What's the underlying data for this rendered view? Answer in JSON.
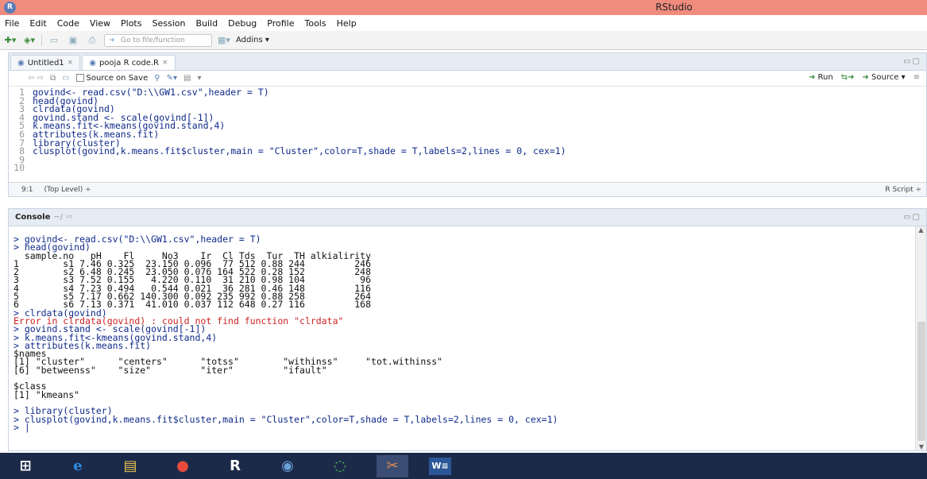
{
  "window": {
    "title": "RStudio",
    "logo": "R"
  },
  "menu": [
    "File",
    "Edit",
    "Code",
    "View",
    "Plots",
    "Session",
    "Build",
    "Debug",
    "Profile",
    "Tools",
    "Help"
  ],
  "toolbar": {
    "goto_placeholder": "Go to file/function",
    "addins": "Addins ▾"
  },
  "editor": {
    "tabs": [
      {
        "label": "Untitled1"
      },
      {
        "label": "pooja R code.R"
      }
    ],
    "source_on_save": "Source on Save",
    "run": "Run",
    "source": "Source",
    "lines": [
      "govind<- read.csv(\"D:\\\\GW1.csv\",header = T)",
      "head(govind)",
      "clrdata(govind)",
      "govind.stand <- scale(govind[-1])",
      "k.means.fit<-kmeans(govind.stand,4)",
      "attributes(k.means.fit)",
      "library(cluster)",
      "clusplot(govind,k.means.fit$cluster,main = \"Cluster\",color=T,shade = T,labels=2,lines = 0, cex=1)",
      "",
      ""
    ],
    "status": {
      "position": "9:1",
      "scope": "(Top Level) ÷",
      "type": "R Script ÷"
    }
  },
  "console": {
    "title": "Console",
    "path": "~/",
    "lines": [
      {
        "t": "in",
        "s": "> govind<- read.csv(\"D:\\\\GW1.csv\",header = T)"
      },
      {
        "t": "in",
        "s": "> head(govind)"
      },
      {
        "t": "out",
        "s": "  sample.no   pH    Fl     No3    Ir  Cl Tds  Tur  TH alkialirity"
      },
      {
        "t": "out",
        "s": "1        s1 7.46 0.325  23.150 0.096  77 512 0.88 244         246"
      },
      {
        "t": "out",
        "s": "2        s2 6.48 0.245  23.050 0.076 164 522 0.28 152         248"
      },
      {
        "t": "out",
        "s": "3        s3 7.52 0.155   4.220 0.110  31 210 0.98 104          96"
      },
      {
        "t": "out",
        "s": "4        s4 7.23 0.494   0.544 0.021  36 281 0.46 148         116"
      },
      {
        "t": "out",
        "s": "5        s5 7.17 0.662 140.300 0.092 235 992 0.88 258         264"
      },
      {
        "t": "out",
        "s": "6        s6 7.13 0.371  41.010 0.037 112 648 0.27 116         168"
      },
      {
        "t": "in",
        "s": "> clrdata(govind)"
      },
      {
        "t": "err",
        "s": "Error in clrdata(govind) : could not find function \"clrdata\""
      },
      {
        "t": "in",
        "s": "> govind.stand <- scale(govind[-1])"
      },
      {
        "t": "in",
        "s": "> k.means.fit<-kmeans(govind.stand,4)"
      },
      {
        "t": "in",
        "s": "> attributes(k.means.fit)"
      },
      {
        "t": "out",
        "s": "$names"
      },
      {
        "t": "out",
        "s": "[1] \"cluster\"      \"centers\"      \"totss\"        \"withinss\"     \"tot.withinss\""
      },
      {
        "t": "out",
        "s": "[6] \"betweenss\"    \"size\"         \"iter\"         \"ifault\""
      },
      {
        "t": "out",
        "s": ""
      },
      {
        "t": "out",
        "s": "$class"
      },
      {
        "t": "out",
        "s": "[1] \"kmeans\""
      },
      {
        "t": "out",
        "s": ""
      },
      {
        "t": "in",
        "s": "> library(cluster)"
      },
      {
        "t": "in",
        "s": "> clusplot(govind,k.means.fit$cluster,main = \"Cluster\",color=T,shade = T,labels=2,lines = 0, cex=1)"
      },
      {
        "t": "in",
        "s": "> |"
      }
    ]
  },
  "taskbar": [
    {
      "name": "start-icon",
      "glyph": "⊞"
    },
    {
      "name": "internet-explorer-icon",
      "glyph": "e"
    },
    {
      "name": "file-explorer-icon",
      "glyph": "▤"
    },
    {
      "name": "chrome-icon",
      "glyph": "●"
    },
    {
      "name": "r-gui-icon",
      "glyph": "R"
    },
    {
      "name": "rstudio-icon",
      "glyph": "◉"
    },
    {
      "name": "loading-icon",
      "glyph": "◌"
    },
    {
      "name": "snipping-icon",
      "glyph": "✂"
    },
    {
      "name": "word-icon",
      "glyph": "W≡"
    }
  ]
}
